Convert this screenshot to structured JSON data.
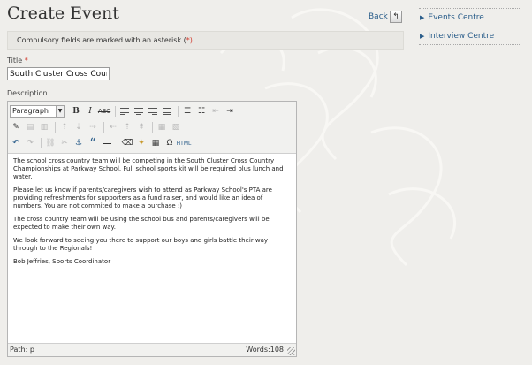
{
  "page": {
    "title": "Create Event",
    "back_label": "Back",
    "notice_text": "Compulsory fields are marked with an asterisk (",
    "notice_asterisk": "*",
    "notice_end": ")"
  },
  "sidebar": {
    "items": [
      {
        "label": "Events Centre"
      },
      {
        "label": "Interview Centre"
      }
    ]
  },
  "form": {
    "title_label": "Title",
    "required_mark": "*",
    "title_value": "South Cluster Cross Count",
    "description_label": "Description"
  },
  "editor": {
    "format_select": "Paragraph",
    "status_path": "Path: p",
    "word_count": "Words:108",
    "paragraphs": [
      "The school cross country team will be competing in the South Cluster Cross Country Championships at Parkway School. Full school sports kit will be required plus lunch and water.",
      "Please let us know if parents/caregivers wish to attend as Parkway School's PTA are providing refreshments for supporters as a fund raiser, and would like an idea of numbers. You are not commited to make a purchase :)",
      "The cross country team will be using the school bus and parents/caregivers will be expected to make their own way.",
      "We look forward to seeing you there to support our boys and girls battle their way through to the Regionals!",
      "Bob Jeffries, Sports Coordinator"
    ]
  },
  "toolbar": {
    "bold": "B",
    "italic": "I",
    "strike": "ABC",
    "blockquote": "“",
    "omega": "Ω",
    "html": "HTML"
  },
  "colors": {
    "link": "#2a5d8a",
    "required": "#d23a2e",
    "background": "#efeeeb"
  }
}
